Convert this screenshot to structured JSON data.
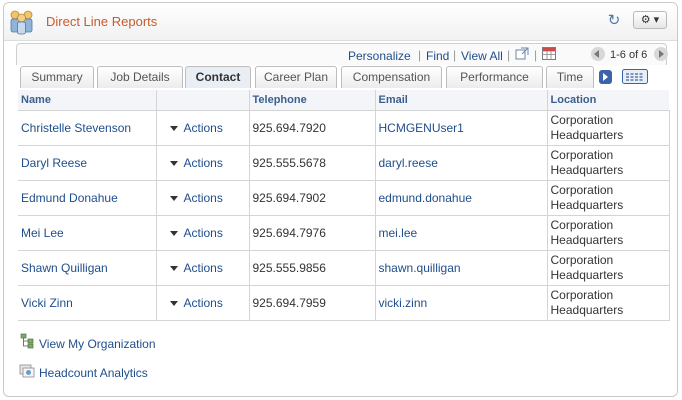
{
  "header": {
    "title": "Direct Line Reports",
    "refresh_icon": "refresh-icon",
    "gear_icon": "gear-icon",
    "gear_label": "⚙ ▾"
  },
  "toolbar": {
    "personalize": "Personalize",
    "find": "Find",
    "view_all": "View All",
    "range": "1-6 of 6",
    "separator": "|"
  },
  "tabs": [
    {
      "label": "Summary",
      "active": false
    },
    {
      "label": "Job Details",
      "active": false
    },
    {
      "label": "Contact",
      "active": true
    },
    {
      "label": "Career Plan",
      "active": false
    },
    {
      "label": "Compensation",
      "active": false
    },
    {
      "label": "Performance",
      "active": false
    },
    {
      "label": "Time",
      "active": false
    }
  ],
  "columns": {
    "name": "Name",
    "actions": "",
    "telephone": "Telephone",
    "email": "Email",
    "location": "Location"
  },
  "rows": [
    {
      "name": "Christelle Stevenson",
      "actions": "Actions",
      "telephone": "925.694.7920",
      "email": "HCMGENUser1",
      "location": [
        "Corporation",
        "Headquarters"
      ]
    },
    {
      "name": "Daryl Reese",
      "actions": "Actions",
      "telephone": "925.555.5678",
      "email": "daryl.reese",
      "location": [
        "Corporation",
        "Headquarters"
      ]
    },
    {
      "name": "Edmund Donahue",
      "actions": "Actions",
      "telephone": "925.694.7902",
      "email": "edmund.donahue",
      "location": [
        "Corporation",
        "Headquarters"
      ]
    },
    {
      "name": "Mei Lee",
      "actions": "Actions",
      "telephone": "925.694.7976",
      "email": "mei.lee",
      "location": [
        "Corporation",
        "Headquarters"
      ]
    },
    {
      "name": "Shawn Quilligan",
      "actions": "Actions",
      "telephone": "925.555.9856",
      "email": "shawn.quilligan",
      "location": [
        "Corporation",
        "Headquarters"
      ]
    },
    {
      "name": "Vicki Zinn",
      "actions": "Actions",
      "telephone": "925.694.7959",
      "email": "vicki.zinn",
      "location": [
        "Corporation",
        "Headquarters"
      ]
    }
  ],
  "related_links": {
    "view_org": "View My Organization",
    "headcount": "Headcount Analytics"
  },
  "colors": {
    "title": "#c95a2a",
    "link": "#1f4e8c",
    "header_text": "#3b5f8f"
  }
}
